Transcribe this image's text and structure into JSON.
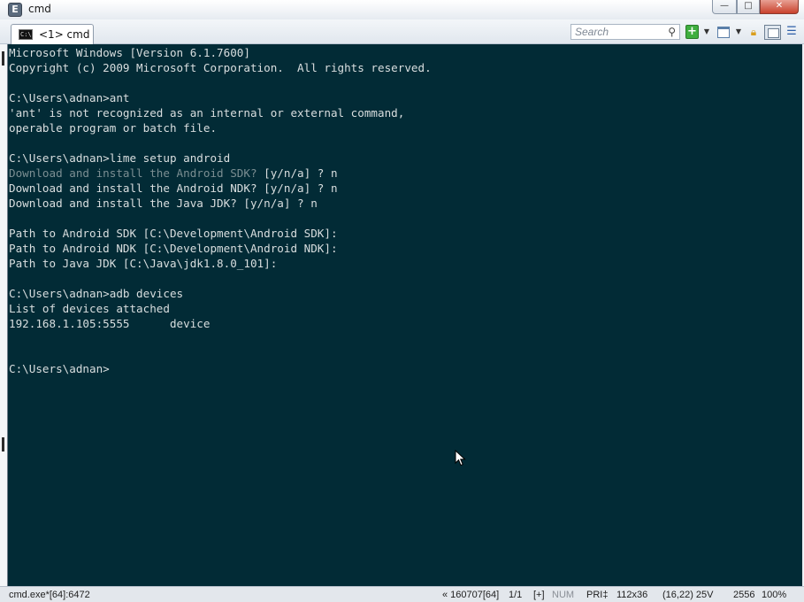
{
  "window": {
    "title": "cmd",
    "app_icon_letter": "E",
    "controls": {
      "minimize": "—",
      "maximize": "□",
      "close": "✕"
    }
  },
  "toolbar": {
    "tab_label": "<1> cmd",
    "tab_icon_text": "C:\\",
    "search_placeholder": "Search",
    "icons": [
      "search-icon",
      "new-console-icon",
      "dropdown-icon",
      "window-icon",
      "dropdown-icon",
      "lock-icon",
      "panel-icon",
      "menu-icon"
    ]
  },
  "console": {
    "background": "#022b36",
    "lines": [
      {
        "text": "Microsoft Windows [Version 6.1.7600]",
        "dim": false
      },
      {
        "text": "Copyright (c) 2009 Microsoft Corporation.  All rights reserved.",
        "dim": false
      },
      {
        "text": "",
        "dim": false
      },
      {
        "text": "C:\\Users\\adnan>ant",
        "dim": false
      },
      {
        "text": "'ant' is not recognized as an internal or external command,",
        "dim": false
      },
      {
        "text": "operable program or batch file.",
        "dim": false
      },
      {
        "text": "",
        "dim": false
      },
      {
        "text": "C:\\Users\\adnan>lime setup android",
        "dim": false
      },
      {
        "text": "Download and install the Android SDK? ",
        "dim": true,
        "suffix": "[y/n/a] ? n"
      },
      {
        "text": "Download and install the Android NDK? [y/n/a] ? n",
        "dim": false
      },
      {
        "text": "Download and install the Java JDK? [y/n/a] ? n",
        "dim": false
      },
      {
        "text": "",
        "dim": false
      },
      {
        "text": "Path to Android SDK [C:\\Development\\Android SDK]:",
        "dim": false
      },
      {
        "text": "Path to Android NDK [C:\\Development\\Android NDK]:",
        "dim": false
      },
      {
        "text": "Path to Java JDK [C:\\Java\\jdk1.8.0_101]:",
        "dim": false
      },
      {
        "text": "",
        "dim": false
      },
      {
        "text": "C:\\Users\\adnan>adb devices",
        "dim": false
      },
      {
        "text": "List of devices attached",
        "dim": false
      },
      {
        "text": "192.168.1.105:5555      device",
        "dim": false
      },
      {
        "text": "",
        "dim": false
      },
      {
        "text": "",
        "dim": false
      },
      {
        "text": "C:\\Users\\adnan>",
        "dim": false
      }
    ]
  },
  "statusbar": {
    "process": "cmd.exe*[64]:6472",
    "build": "« 160707[64]",
    "pages": "1/1",
    "plus": "[+]",
    "num": "NUM",
    "pri": "PRI‡",
    "size": "112x36",
    "cursor_pos": "(16,22) 25V",
    "pid": "2556",
    "zoom": "100%"
  }
}
